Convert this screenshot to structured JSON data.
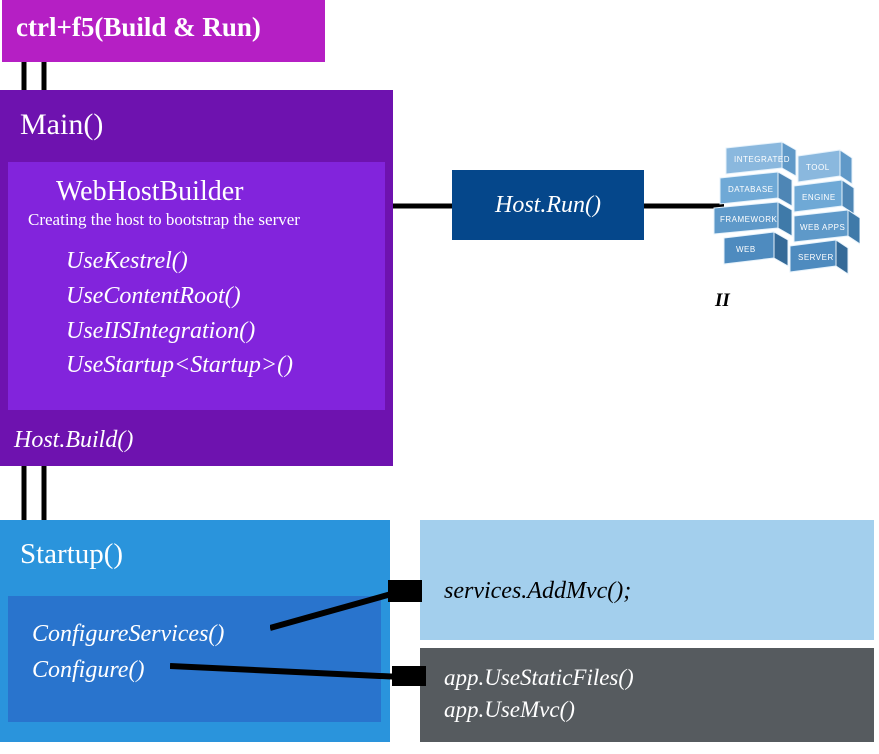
{
  "ctrl": {
    "label": "ctrl+f5(Build & Run)"
  },
  "main": {
    "title": "Main()",
    "webhost": {
      "title": "WebHostBuilder",
      "subtitle": "Creating the host to bootstrap the server",
      "methods": [
        "UseKestrel()",
        "UseContentRoot()",
        "UseIISIntegration()",
        "UseStartup<Startup>()"
      ]
    },
    "hostBuild": "Host.Build()"
  },
  "hostRun": "Host.Run()",
  "server": {
    "label": "II",
    "cubes": [
      "INTEGRATED",
      "TOOL",
      "DATABASE",
      "ENGINE",
      "FRAMEWORK",
      "WEB APPS",
      "WEB",
      "SERVER"
    ]
  },
  "startup": {
    "title": "Startup()",
    "methods": {
      "configureServices": "ConfigureServices()",
      "configure": "Configure()"
    }
  },
  "addMvc": "services.AddMvc();",
  "configureBody": {
    "line1": "app.UseStaticFiles()",
    "line2": "app.UseMvc()"
  }
}
